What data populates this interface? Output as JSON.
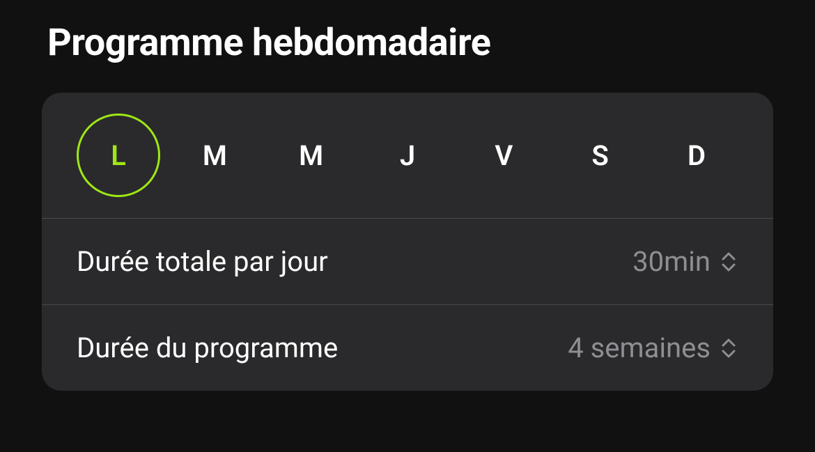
{
  "title": "Programme hebdomadaire",
  "days": [
    {
      "label": "L",
      "selected": true
    },
    {
      "label": "M",
      "selected": false
    },
    {
      "label": "M",
      "selected": false
    },
    {
      "label": "J",
      "selected": false
    },
    {
      "label": "V",
      "selected": false
    },
    {
      "label": "S",
      "selected": false
    },
    {
      "label": "D",
      "selected": false
    }
  ],
  "settings": {
    "dailyDuration": {
      "label": "Durée totale par jour",
      "value": "30min"
    },
    "programDuration": {
      "label": "Durée du programme",
      "value": "4 semaines"
    }
  },
  "colors": {
    "accent": "#9FE715",
    "background": "#111111",
    "card": "#2a2a2c",
    "textSecondary": "#8e8e93"
  }
}
